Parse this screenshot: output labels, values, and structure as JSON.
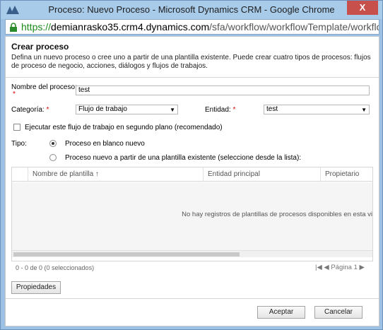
{
  "window": {
    "title": "Proceso: Nuevo Proceso - Microsoft Dynamics CRM - Google Chrome",
    "close_glyph": "X"
  },
  "address": {
    "scheme": "https://",
    "host": "demianrasko35.crm4.dynamics.com",
    "path": "/sfa/workflow/workflowTemplate/workflowT"
  },
  "header": {
    "title": "Crear proceso",
    "description": "Defina un nuevo proceso o cree uno a partir de una plantilla existente. Puede crear cuatro tipos de procesos: flujos de proceso de negocio, acciones, diálogos y flujos de trabajos."
  },
  "form": {
    "name_label": "Nombre del proceso:",
    "name_value": "test",
    "required_mark": "*",
    "category_label": "Categoría:",
    "category_value": "Flujo de trabajo",
    "entity_label": "Entidad:",
    "entity_value": "test",
    "dropdown_glyph": "▼",
    "background_label": "Ejecutar este flujo de trabajo en segundo plano (recomendado)",
    "type_label": "Tipo:",
    "type_option_blank": "Proceso en blanco nuevo",
    "type_option_template": "Proceso nuevo a partir de una plantilla existente (seleccione desde la lista):"
  },
  "grid": {
    "columns": [
      "Nombre de plantilla ↑",
      "Entidad principal",
      "Propietario"
    ],
    "empty_message": "No hay registros de plantillas de procesos disponibles en esta vi",
    "status": "0 - 0 de 0 (0 seleccionados)",
    "pager_first": "|◀",
    "pager_prev": "◀",
    "page_label": "Página 1",
    "pager_next": "▶"
  },
  "actions": {
    "properties_label": "Propiedades",
    "accept_label": "Aceptar",
    "cancel_label": "Cancelar"
  },
  "colors": {
    "titlebar": "#a9cbea",
    "close_button": "#c7504c",
    "required": "#e00000",
    "url_scheme": "#1a8c1a"
  }
}
